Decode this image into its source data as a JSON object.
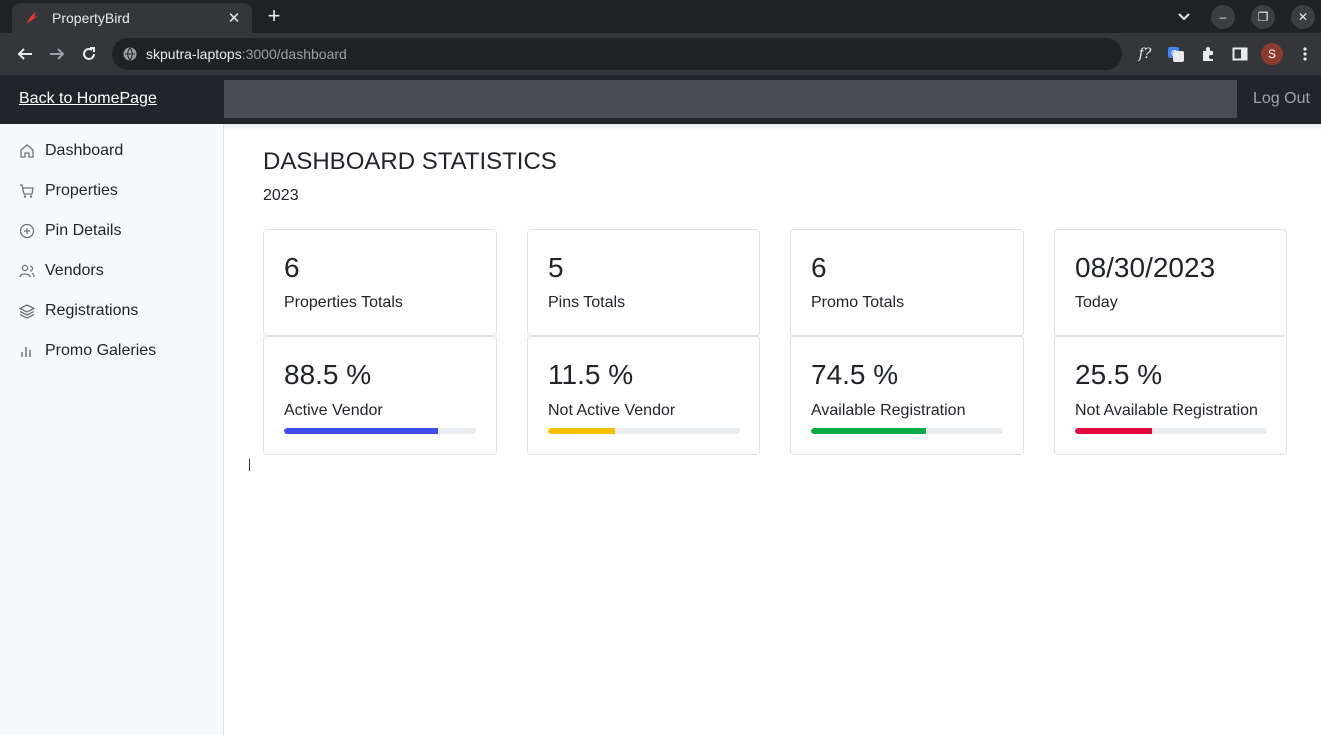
{
  "browser": {
    "tab_title": "PropertyBird",
    "url_host": "skputra-laptops",
    "url_path": ":3000/dashboard",
    "profile_initial": "S",
    "ext_f_label": "f?"
  },
  "header": {
    "back_link": "Back to HomePage",
    "logout": "Log Out"
  },
  "sidebar": {
    "items": [
      {
        "label": "Dashboard",
        "icon": "home-icon"
      },
      {
        "label": "Properties",
        "icon": "cart-icon"
      },
      {
        "label": "Pin Details",
        "icon": "plus-circle-icon"
      },
      {
        "label": "Vendors",
        "icon": "people-icon"
      },
      {
        "label": "Registrations",
        "icon": "layers-icon"
      },
      {
        "label": "Promo Galeries",
        "icon": "bar-chart-icon"
      }
    ]
  },
  "main": {
    "title": "DASHBOARD STATISTICS",
    "year": "2023",
    "stats": [
      {
        "value": "6",
        "label": "Properties Totals"
      },
      {
        "value": "5",
        "label": "Pins Totals"
      },
      {
        "value": "6",
        "label": "Promo Totals"
      },
      {
        "value": "08/30/2023",
        "label": "Today"
      }
    ],
    "progress": [
      {
        "value": "88.5 %",
        "label": "Active Vendor",
        "fill": 80,
        "color": "#3f4cf0"
      },
      {
        "value": "11.5 %",
        "label": "Not Active Vendor",
        "fill": 35,
        "color": "#f5c000"
      },
      {
        "value": "74.5 %",
        "label": "Available Registration",
        "fill": 60,
        "color": "#0aad4a"
      },
      {
        "value": "25.5 %",
        "label": "Not Available Registration",
        "fill": 40,
        "color": "#e3063f"
      }
    ]
  }
}
